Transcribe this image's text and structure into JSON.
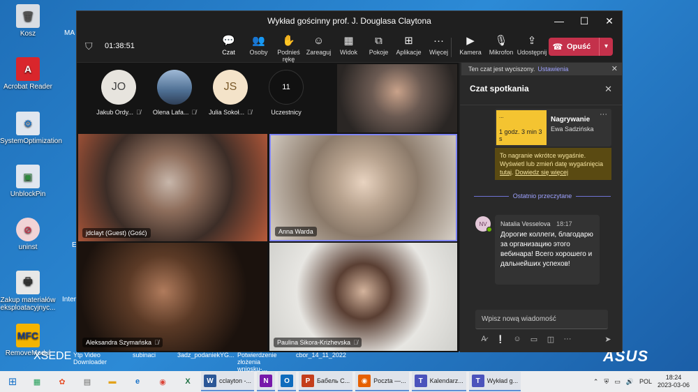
{
  "desktop": {
    "icons": [
      {
        "label": "Kosz"
      },
      {
        "label": "Acrobat Reader"
      },
      {
        "label": "SystemOptimization"
      },
      {
        "label": "UnblockPin"
      },
      {
        "label": "uninst"
      },
      {
        "label": "Zakup materiałów eksploatacyjnyc..."
      },
      {
        "label": "RemoveModul"
      }
    ],
    "partial_labels": [
      "MA",
      "E",
      "Inter",
      "Ytp Video Downloader",
      "subinaci",
      "3adz_podaniekYG...",
      "Potwierdzenie złożenia wniosku-...",
      "cbor_14_11_2022"
    ],
    "brand": "ASUS",
    "xsede": "XSEDE"
  },
  "window": {
    "title": "Wykład gościnny prof. J. Douglasa Claytona",
    "controls": [
      "—",
      "☐",
      "✕"
    ]
  },
  "toolbar": {
    "timer": "01:38:51",
    "tools": [
      {
        "label": "Czat",
        "icon": "💬"
      },
      {
        "label": "Osoby",
        "icon": "👥"
      },
      {
        "label": "Podnieś rękę",
        "icon": "✋"
      },
      {
        "label": "Zareaguj",
        "icon": "☺"
      },
      {
        "label": "Widok",
        "icon": "▦"
      },
      {
        "label": "Pokoje",
        "icon": "⧉"
      },
      {
        "label": "Aplikacje",
        "icon": "⊞"
      },
      {
        "label": "Więcej",
        "icon": "···"
      }
    ],
    "media": [
      {
        "label": "Kamera",
        "icon": "▶"
      },
      {
        "label": "Mikrofon",
        "icon": "🎙"
      },
      {
        "label": "Udostępnij",
        "icon": "⇪"
      }
    ],
    "leave": "Opuść"
  },
  "stage": {
    "avatars": [
      {
        "initials": "JO",
        "name": "Jakub Ordy...",
        "bg": "#e7e4de"
      },
      {
        "initials": "",
        "name": "Olena Lafa...",
        "bg": "#6f8fb5"
      },
      {
        "initials": "JS",
        "name": "Julia Sokoł...",
        "bg": "#f4e3c9"
      },
      {
        "initials": "11",
        "name": "Uczestnicy",
        "bg": "#111111"
      }
    ],
    "tiles": [
      {
        "name": "jdclayt (Guest) (Gość)"
      },
      {
        "name": "Anna Warda"
      },
      {
        "name": "Aleksandra Szymańska"
      },
      {
        "name": "Paulina Sikora-Krizhevska"
      }
    ]
  },
  "chat": {
    "notice": "Ten czat jest wyciszony.",
    "notice_link": "Ustawienia",
    "title": "Czat spotkania",
    "recording": {
      "thumb_text": "...",
      "duration": "1 godz. 3 min 3 s",
      "title": "Nagrywanie",
      "author": "Ewa Sadzińska",
      "warning": "To nagranie wkrótce wygaśnie. Wyświetl lub zmień datę wygaśnięcia",
      "warning_link1": "tutaj",
      "warning_link2": "Dowiedz się więcej"
    },
    "read_marker": "Ostatnio przeczytane",
    "message": {
      "initials": "NV",
      "author": "Natalia Vesselova",
      "time": "18:17",
      "text": "Дорогие коллеги, благодарю за организацию этого вебинара! Всего хорошего и дальнейших успехов!"
    },
    "compose_placeholder": "Wpisz nową wiadomość"
  },
  "taskbar": {
    "apps": [
      {
        "label": "cclayton -...",
        "letter": "W",
        "color": "#2b5797"
      },
      {
        "label": "",
        "letter": "N",
        "color": "#7719aa"
      },
      {
        "label": "",
        "letter": "O",
        "color": "#0f6cbd"
      },
      {
        "label": "Бабель С...",
        "letter": "P",
        "color": "#c43e1c"
      },
      {
        "label": "Poczta —...",
        "letter": "◉",
        "color": "#e66000"
      },
      {
        "label": "Kalendarz...",
        "letter": "T",
        "color": "#4b53bc"
      },
      {
        "label": "Wykład g...",
        "letter": "T",
        "color": "#4b53bc"
      }
    ],
    "lang": "POL",
    "time": "18:24",
    "date": "2023-03-06"
  }
}
